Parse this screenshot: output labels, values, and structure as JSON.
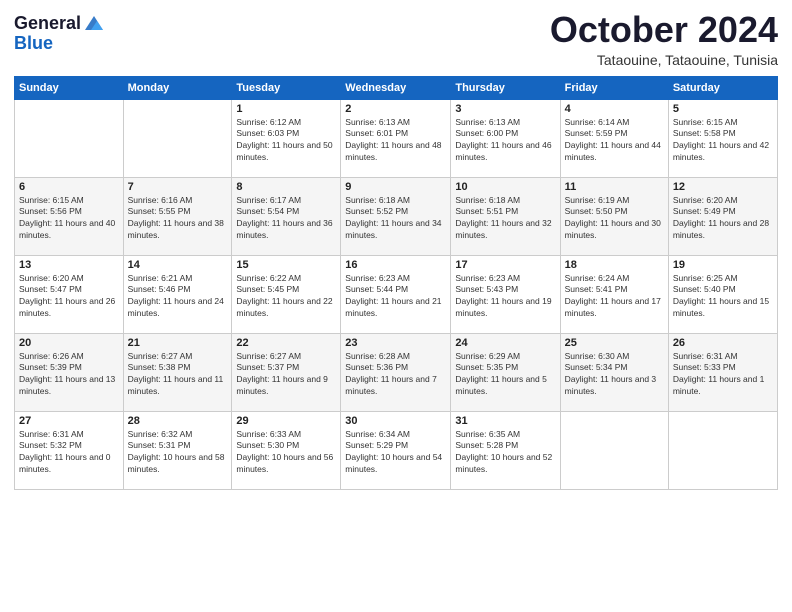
{
  "logo": {
    "line1": "General",
    "line2": "Blue"
  },
  "header": {
    "month": "October 2024",
    "location": "Tataouine, Tataouine, Tunisia"
  },
  "weekdays": [
    "Sunday",
    "Monday",
    "Tuesday",
    "Wednesday",
    "Thursday",
    "Friday",
    "Saturday"
  ],
  "weeks": [
    [
      {
        "day": "",
        "sunrise": "",
        "sunset": "",
        "daylight": ""
      },
      {
        "day": "",
        "sunrise": "",
        "sunset": "",
        "daylight": ""
      },
      {
        "day": "1",
        "sunrise": "Sunrise: 6:12 AM",
        "sunset": "Sunset: 6:03 PM",
        "daylight": "Daylight: 11 hours and 50 minutes."
      },
      {
        "day": "2",
        "sunrise": "Sunrise: 6:13 AM",
        "sunset": "Sunset: 6:01 PM",
        "daylight": "Daylight: 11 hours and 48 minutes."
      },
      {
        "day": "3",
        "sunrise": "Sunrise: 6:13 AM",
        "sunset": "Sunset: 6:00 PM",
        "daylight": "Daylight: 11 hours and 46 minutes."
      },
      {
        "day": "4",
        "sunrise": "Sunrise: 6:14 AM",
        "sunset": "Sunset: 5:59 PM",
        "daylight": "Daylight: 11 hours and 44 minutes."
      },
      {
        "day": "5",
        "sunrise": "Sunrise: 6:15 AM",
        "sunset": "Sunset: 5:58 PM",
        "daylight": "Daylight: 11 hours and 42 minutes."
      }
    ],
    [
      {
        "day": "6",
        "sunrise": "Sunrise: 6:15 AM",
        "sunset": "Sunset: 5:56 PM",
        "daylight": "Daylight: 11 hours and 40 minutes."
      },
      {
        "day": "7",
        "sunrise": "Sunrise: 6:16 AM",
        "sunset": "Sunset: 5:55 PM",
        "daylight": "Daylight: 11 hours and 38 minutes."
      },
      {
        "day": "8",
        "sunrise": "Sunrise: 6:17 AM",
        "sunset": "Sunset: 5:54 PM",
        "daylight": "Daylight: 11 hours and 36 minutes."
      },
      {
        "day": "9",
        "sunrise": "Sunrise: 6:18 AM",
        "sunset": "Sunset: 5:52 PM",
        "daylight": "Daylight: 11 hours and 34 minutes."
      },
      {
        "day": "10",
        "sunrise": "Sunrise: 6:18 AM",
        "sunset": "Sunset: 5:51 PM",
        "daylight": "Daylight: 11 hours and 32 minutes."
      },
      {
        "day": "11",
        "sunrise": "Sunrise: 6:19 AM",
        "sunset": "Sunset: 5:50 PM",
        "daylight": "Daylight: 11 hours and 30 minutes."
      },
      {
        "day": "12",
        "sunrise": "Sunrise: 6:20 AM",
        "sunset": "Sunset: 5:49 PM",
        "daylight": "Daylight: 11 hours and 28 minutes."
      }
    ],
    [
      {
        "day": "13",
        "sunrise": "Sunrise: 6:20 AM",
        "sunset": "Sunset: 5:47 PM",
        "daylight": "Daylight: 11 hours and 26 minutes."
      },
      {
        "day": "14",
        "sunrise": "Sunrise: 6:21 AM",
        "sunset": "Sunset: 5:46 PM",
        "daylight": "Daylight: 11 hours and 24 minutes."
      },
      {
        "day": "15",
        "sunrise": "Sunrise: 6:22 AM",
        "sunset": "Sunset: 5:45 PM",
        "daylight": "Daylight: 11 hours and 22 minutes."
      },
      {
        "day": "16",
        "sunrise": "Sunrise: 6:23 AM",
        "sunset": "Sunset: 5:44 PM",
        "daylight": "Daylight: 11 hours and 21 minutes."
      },
      {
        "day": "17",
        "sunrise": "Sunrise: 6:23 AM",
        "sunset": "Sunset: 5:43 PM",
        "daylight": "Daylight: 11 hours and 19 minutes."
      },
      {
        "day": "18",
        "sunrise": "Sunrise: 6:24 AM",
        "sunset": "Sunset: 5:41 PM",
        "daylight": "Daylight: 11 hours and 17 minutes."
      },
      {
        "day": "19",
        "sunrise": "Sunrise: 6:25 AM",
        "sunset": "Sunset: 5:40 PM",
        "daylight": "Daylight: 11 hours and 15 minutes."
      }
    ],
    [
      {
        "day": "20",
        "sunrise": "Sunrise: 6:26 AM",
        "sunset": "Sunset: 5:39 PM",
        "daylight": "Daylight: 11 hours and 13 minutes."
      },
      {
        "day": "21",
        "sunrise": "Sunrise: 6:27 AM",
        "sunset": "Sunset: 5:38 PM",
        "daylight": "Daylight: 11 hours and 11 minutes."
      },
      {
        "day": "22",
        "sunrise": "Sunrise: 6:27 AM",
        "sunset": "Sunset: 5:37 PM",
        "daylight": "Daylight: 11 hours and 9 minutes."
      },
      {
        "day": "23",
        "sunrise": "Sunrise: 6:28 AM",
        "sunset": "Sunset: 5:36 PM",
        "daylight": "Daylight: 11 hours and 7 minutes."
      },
      {
        "day": "24",
        "sunrise": "Sunrise: 6:29 AM",
        "sunset": "Sunset: 5:35 PM",
        "daylight": "Daylight: 11 hours and 5 minutes."
      },
      {
        "day": "25",
        "sunrise": "Sunrise: 6:30 AM",
        "sunset": "Sunset: 5:34 PM",
        "daylight": "Daylight: 11 hours and 3 minutes."
      },
      {
        "day": "26",
        "sunrise": "Sunrise: 6:31 AM",
        "sunset": "Sunset: 5:33 PM",
        "daylight": "Daylight: 11 hours and 1 minute."
      }
    ],
    [
      {
        "day": "27",
        "sunrise": "Sunrise: 6:31 AM",
        "sunset": "Sunset: 5:32 PM",
        "daylight": "Daylight: 11 hours and 0 minutes."
      },
      {
        "day": "28",
        "sunrise": "Sunrise: 6:32 AM",
        "sunset": "Sunset: 5:31 PM",
        "daylight": "Daylight: 10 hours and 58 minutes."
      },
      {
        "day": "29",
        "sunrise": "Sunrise: 6:33 AM",
        "sunset": "Sunset: 5:30 PM",
        "daylight": "Daylight: 10 hours and 56 minutes."
      },
      {
        "day": "30",
        "sunrise": "Sunrise: 6:34 AM",
        "sunset": "Sunset: 5:29 PM",
        "daylight": "Daylight: 10 hours and 54 minutes."
      },
      {
        "day": "31",
        "sunrise": "Sunrise: 6:35 AM",
        "sunset": "Sunset: 5:28 PM",
        "daylight": "Daylight: 10 hours and 52 minutes."
      },
      {
        "day": "",
        "sunrise": "",
        "sunset": "",
        "daylight": ""
      },
      {
        "day": "",
        "sunrise": "",
        "sunset": "",
        "daylight": ""
      }
    ]
  ]
}
